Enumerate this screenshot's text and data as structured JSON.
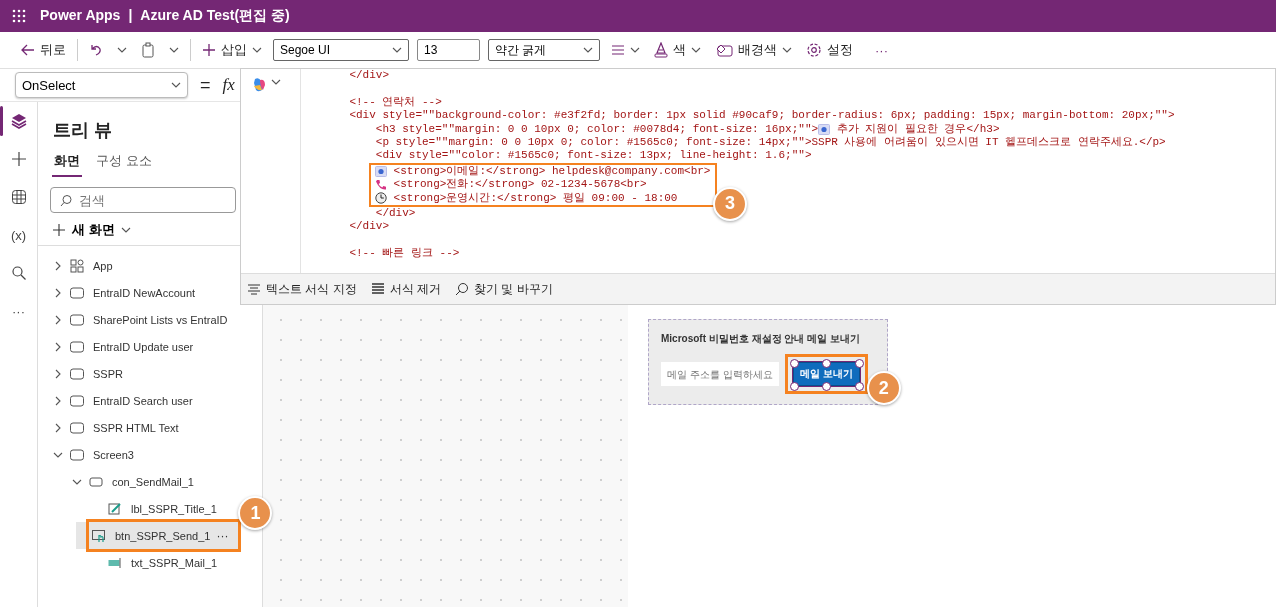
{
  "header": {
    "app_name": "Power Apps",
    "separator": "|",
    "document_title": "Azure AD Test(편집 중)"
  },
  "toolbar": {
    "back": "뒤로",
    "insert": "삽입",
    "font": "Segoe UI",
    "font_size": "13",
    "font_weight": "약간 굵게",
    "color_label": "색",
    "fill": "배경색",
    "settings": "설정",
    "more": "···"
  },
  "formula_bar": {
    "property": "OnSelect",
    "equals": "=",
    "fx": "fx"
  },
  "left_rail": [
    {
      "kind": "layers",
      "selected": true
    },
    {
      "kind": "plus",
      "selected": false
    },
    {
      "kind": "data",
      "selected": false
    },
    {
      "kind": "variables",
      "label": "(x)",
      "selected": false
    },
    {
      "kind": "search",
      "selected": false
    },
    {
      "kind": "more",
      "label": "···",
      "selected": false
    }
  ],
  "tree_view": {
    "title": "트리 뷰",
    "tabs": [
      {
        "label": "화면",
        "selected": true
      },
      {
        "label": "구성 요소",
        "selected": false
      }
    ],
    "search": {
      "placeholder": "검색"
    },
    "new_screen": "새 화면",
    "items": [
      {
        "label": "App",
        "kind": "app",
        "expanded": false,
        "selected": false
      },
      {
        "label": "EntraID NewAccount",
        "kind": "screen",
        "expanded": false,
        "selected": false
      },
      {
        "label": "SharePoint Lists vs EntraID",
        "kind": "screen",
        "expanded": false,
        "selected": false
      },
      {
        "label": "EntraID Update user",
        "kind": "screen",
        "expanded": false,
        "selected": false
      },
      {
        "label": "SSPR",
        "kind": "screen",
        "expanded": false,
        "selected": false
      },
      {
        "label": "EntraID Search user",
        "kind": "screen",
        "expanded": false,
        "selected": false
      },
      {
        "label": "SSPR HTML Text",
        "kind": "screen",
        "expanded": false,
        "selected": false
      },
      {
        "label": "Screen3",
        "kind": "screen",
        "expanded": true,
        "selected": false,
        "children": [
          {
            "label": "con_SendMail_1",
            "kind": "container",
            "expanded": true,
            "selected": false,
            "children": [
              {
                "label": "lbl_SSPR_Title_1",
                "kind": "label",
                "selected": false
              },
              {
                "label": "btn_SSPR_Send_1",
                "kind": "button",
                "selected": true,
                "menu": "···",
                "callout": "1"
              },
              {
                "label": "txt_SSPR_Mail_1",
                "kind": "input",
                "selected": false
              }
            ]
          }
        ]
      }
    ]
  },
  "code_editor": {
    "lines": [
      {
        "kind": "text",
        "text": "    </div>"
      },
      {
        "kind": "blank"
      },
      {
        "kind": "text",
        "text": "    <!-- 연락처 -->"
      },
      {
        "kind": "text",
        "text": "    <div style=\"\"background-color: #e3f2fd; border: 1px solid #90caf9; border-radius: 6px; padding: 15px; margin-bottom: 20px;\"\">"
      },
      {
        "kind": "heading_line",
        "text": "        <h3 style=\"\"margin: 0 0 10px 0; color: #0078d4; font-size: 16px;\"\">",
        "after": " 추가 지원이 필요한 경우</h3>"
      },
      {
        "kind": "text",
        "text": "        <p style=\"\"margin: 0 0 10px 0; color: #1565c0; font-size: 14px;\"\">SSPR 사용에 어려움이 있으시면 IT 헬프데스크로 연락주세요.</p>"
      },
      {
        "kind": "text",
        "text": "        <div style=\"\"color: #1565c0; font-size: 13px; line-height: 1.6;\"\">"
      },
      {
        "kind": "group",
        "callout": "3",
        "lines": [
          {
            "kind": "email_line",
            "after": " <strong>이메일:</strong> helpdesk@company.com<br>"
          },
          {
            "kind": "phone_line",
            "after": " <strong>전화:</strong> 02-1234-5678<br>"
          },
          {
            "kind": "hours_line",
            "after": " <strong>운영시간:</strong> 평일 09:00 - 18:00"
          }
        ]
      },
      {
        "kind": "text",
        "text": "        </div>"
      },
      {
        "kind": "text",
        "text": "    </div>"
      },
      {
        "kind": "blank"
      },
      {
        "kind": "text",
        "text": "    <!-- 빠른 링크 -->"
      }
    ]
  },
  "format_bar": [
    {
      "kind": "format",
      "label": "텍스트 서식 지정"
    },
    {
      "kind": "clear",
      "label": "서식 제거"
    },
    {
      "kind": "find",
      "label": "찾기 및 바꾸기"
    }
  ],
  "canvas": {
    "card": {
      "title": "Microsoft 비밀번호 재설정 안내 메일 보내기",
      "email_field": {
        "placeholder": "메일 주소를 입력하세요"
      },
      "send_button": {
        "label": "메일 보내기",
        "selected": true,
        "callout": "2"
      }
    }
  }
}
